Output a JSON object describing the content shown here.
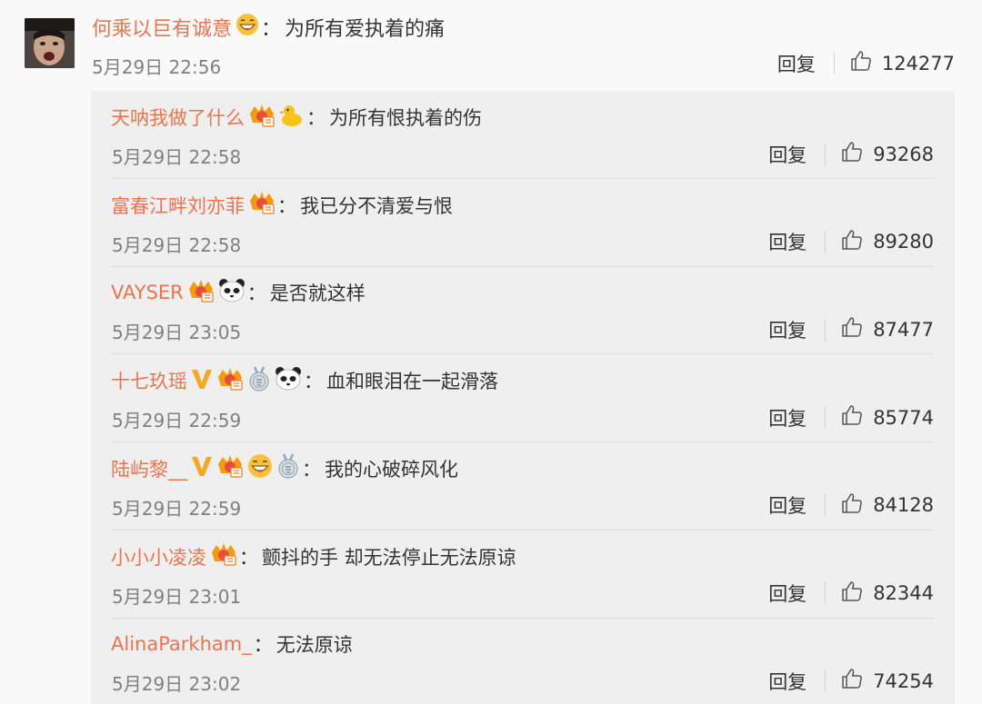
{
  "main_comment": {
    "username": "何乘以巨有诚意",
    "text": "为所有爱执着的痛",
    "time": "5月29日 22:56",
    "reply_label": "回复",
    "likes": "124277"
  },
  "replies": [
    {
      "username": "天呐我做了什么",
      "badges": [
        "vip-crown-icon",
        "duck-icon"
      ],
      "text": "为所有恨执着的伤",
      "time": "5月29日 22:58",
      "reply_label": "回复",
      "likes": "93268"
    },
    {
      "username": "富春江畔刘亦菲",
      "badges": [
        "vip-crown-icon"
      ],
      "text": "我已分不清爱与恨",
      "time": "5月29日 22:58",
      "reply_label": "回复",
      "likes": "89280"
    },
    {
      "username": "VAYSER",
      "badges": [
        "vip-crown-icon",
        "panda-icon"
      ],
      "text": "是否就这样",
      "time": "5月29日 23:05",
      "reply_label": "回复",
      "likes": "87477"
    },
    {
      "username": "十七玖瑶",
      "badges": [
        "verified-v-icon",
        "vip-crown-icon",
        "medal-icon",
        "panda-icon"
      ],
      "text": "血和眼泪在一起滑落",
      "time": "5月29日 22:59",
      "reply_label": "回复",
      "likes": "85774"
    },
    {
      "username": "陆屿黎__",
      "badges": [
        "verified-v-icon",
        "vip-crown-icon",
        "grin-emoji-icon",
        "medal-icon"
      ],
      "text": "我的心破碎风化",
      "time": "5月29日 22:59",
      "reply_label": "回复",
      "likes": "84128"
    },
    {
      "username": "小小小凌凌",
      "badges": [
        "vip-crown-icon"
      ],
      "text": "颤抖的手 却无法停止无法原谅",
      "time": "5月29日 23:01",
      "reply_label": "回复",
      "likes": "82344"
    },
    {
      "username": "AlinaParkham_",
      "badges": [],
      "text": "无法原谅",
      "time": "5月29日 23:02",
      "reply_label": "回复",
      "likes": "74254"
    }
  ],
  "colors": {
    "username": "#eb7350",
    "text": "#333333",
    "meta": "#808080",
    "reply_bg": "#efefef",
    "page_bg": "#f9f9f9"
  }
}
